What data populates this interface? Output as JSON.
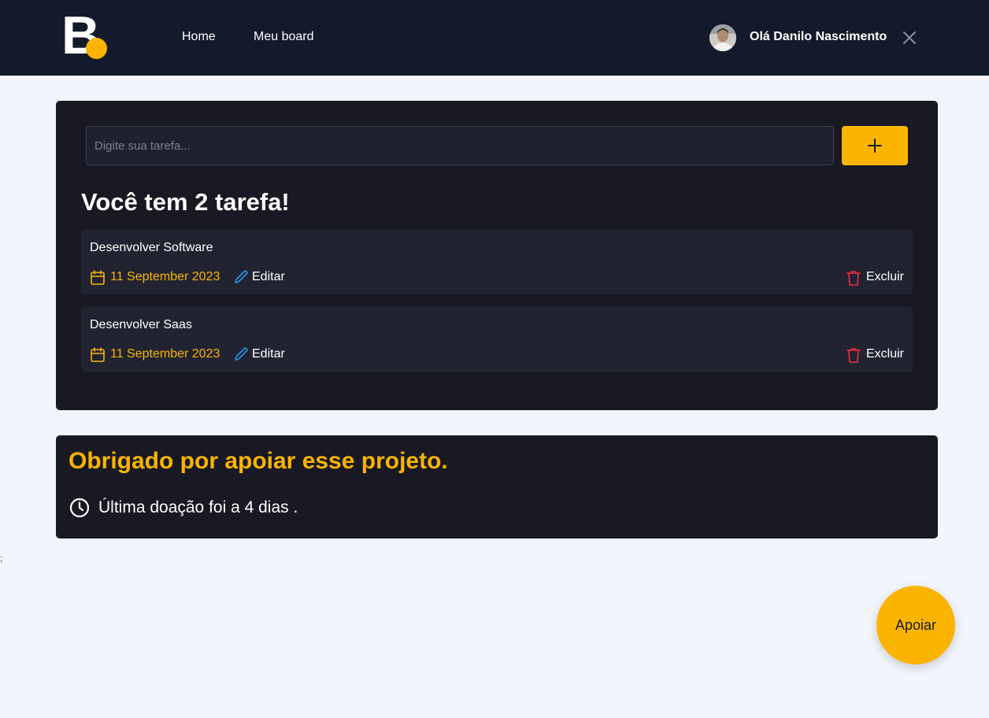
{
  "header": {
    "logo_text": "B",
    "nav": [
      {
        "label": "Home"
      },
      {
        "label": "Meu board"
      }
    ],
    "greeting": "Olá Danilo Nascimento",
    "close_icon": "close-icon"
  },
  "tasks_panel": {
    "input_placeholder": "Digite sua tarefa...",
    "input_value": "",
    "add_icon": "plus-icon",
    "count_text": "Você tem 2 tarefa!",
    "tasks": [
      {
        "title": "Desenvolver Software",
        "date": "11 September 2023",
        "edit_label": "Editar",
        "delete_label": "Excluir"
      },
      {
        "title": "Desenvolver Saas",
        "date": "11 September 2023",
        "edit_label": "Editar",
        "delete_label": "Excluir"
      }
    ]
  },
  "support_panel": {
    "title": "Obrigado por apoiar esse projeto.",
    "last_donation": "Última doação foi a 4 dias ."
  },
  "stray_text": ";",
  "fab_label": "Apoiar",
  "colors": {
    "accent": "#fcb400",
    "header_bg": "#131a2b",
    "panel_bg": "#181922",
    "card_bg": "#212331",
    "page_bg": "#f2f5fc",
    "edit_icon": "#1e9be9",
    "delete_icon": "#ea3140"
  }
}
